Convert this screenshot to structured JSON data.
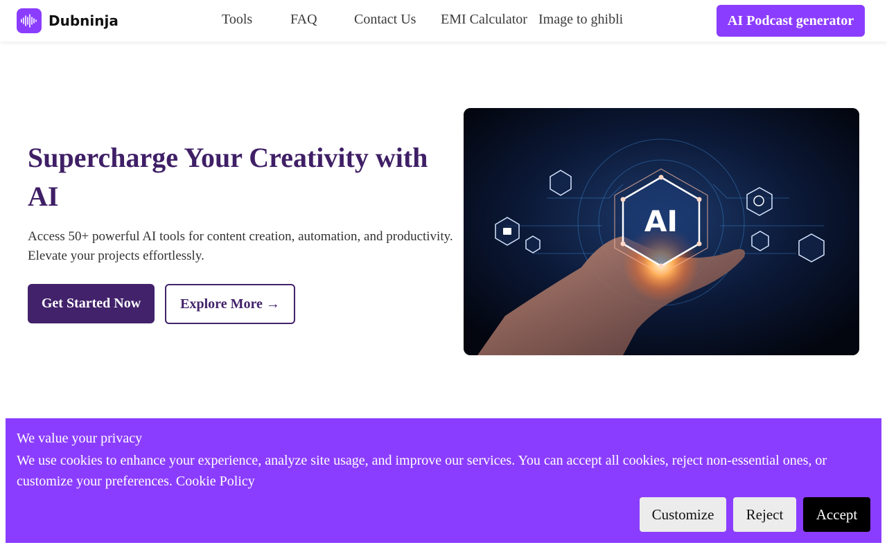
{
  "brand": {
    "name": "Dubninja",
    "logo_icon": "sound-wave-icon"
  },
  "nav": {
    "items": [
      {
        "label": "Tools"
      },
      {
        "label": "FAQ"
      },
      {
        "label": "Contact Us"
      },
      {
        "label": "EMI Calculator"
      },
      {
        "label": "Image to ghibli"
      }
    ],
    "cta_label": "AI Podcast generator"
  },
  "hero": {
    "title": "Supercharge Your Creativity with AI",
    "description": "Access 50+ powerful AI tools for content creation, automation, and productivity. Elevate your projects effortlessly.",
    "primary_button": "Get Started Now",
    "secondary_button": "Explore More →",
    "image": {
      "center_label": "AI"
    }
  },
  "cookie_banner": {
    "title": "We value your privacy",
    "text": "We use cookies to enhance your experience, analyze site usage, and improve our services. You can accept all cookies, reject non-essential ones, or customize your preferences.",
    "link_label": "Cookie Policy",
    "buttons": {
      "customize": "Customize",
      "reject": "Reject",
      "accept": "Accept"
    }
  },
  "colors": {
    "brand_purple": "#8b3dff",
    "heading_purple": "#3f1f66",
    "button_dark_purple": "#42226b",
    "accept_black": "#000000"
  }
}
